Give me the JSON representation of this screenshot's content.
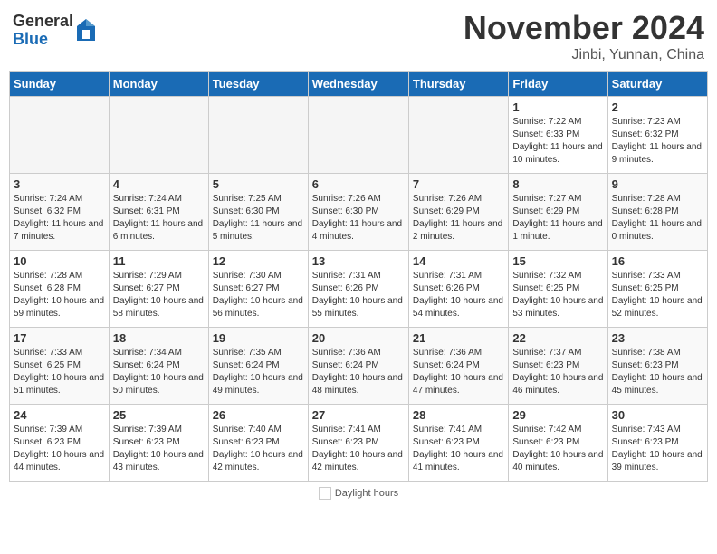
{
  "header": {
    "logo_general": "General",
    "logo_blue": "Blue",
    "title": "November 2024",
    "location": "Jinbi, Yunnan, China"
  },
  "columns": [
    "Sunday",
    "Monday",
    "Tuesday",
    "Wednesday",
    "Thursday",
    "Friday",
    "Saturday"
  ],
  "weeks": [
    [
      {
        "day": "",
        "info": ""
      },
      {
        "day": "",
        "info": ""
      },
      {
        "day": "",
        "info": ""
      },
      {
        "day": "",
        "info": ""
      },
      {
        "day": "",
        "info": ""
      },
      {
        "day": "1",
        "info": "Sunrise: 7:22 AM\nSunset: 6:33 PM\nDaylight: 11 hours and 10 minutes."
      },
      {
        "day": "2",
        "info": "Sunrise: 7:23 AM\nSunset: 6:32 PM\nDaylight: 11 hours and 9 minutes."
      }
    ],
    [
      {
        "day": "3",
        "info": "Sunrise: 7:24 AM\nSunset: 6:32 PM\nDaylight: 11 hours and 7 minutes."
      },
      {
        "day": "4",
        "info": "Sunrise: 7:24 AM\nSunset: 6:31 PM\nDaylight: 11 hours and 6 minutes."
      },
      {
        "day": "5",
        "info": "Sunrise: 7:25 AM\nSunset: 6:30 PM\nDaylight: 11 hours and 5 minutes."
      },
      {
        "day": "6",
        "info": "Sunrise: 7:26 AM\nSunset: 6:30 PM\nDaylight: 11 hours and 4 minutes."
      },
      {
        "day": "7",
        "info": "Sunrise: 7:26 AM\nSunset: 6:29 PM\nDaylight: 11 hours and 2 minutes."
      },
      {
        "day": "8",
        "info": "Sunrise: 7:27 AM\nSunset: 6:29 PM\nDaylight: 11 hours and 1 minute."
      },
      {
        "day": "9",
        "info": "Sunrise: 7:28 AM\nSunset: 6:28 PM\nDaylight: 11 hours and 0 minutes."
      }
    ],
    [
      {
        "day": "10",
        "info": "Sunrise: 7:28 AM\nSunset: 6:28 PM\nDaylight: 10 hours and 59 minutes."
      },
      {
        "day": "11",
        "info": "Sunrise: 7:29 AM\nSunset: 6:27 PM\nDaylight: 10 hours and 58 minutes."
      },
      {
        "day": "12",
        "info": "Sunrise: 7:30 AM\nSunset: 6:27 PM\nDaylight: 10 hours and 56 minutes."
      },
      {
        "day": "13",
        "info": "Sunrise: 7:31 AM\nSunset: 6:26 PM\nDaylight: 10 hours and 55 minutes."
      },
      {
        "day": "14",
        "info": "Sunrise: 7:31 AM\nSunset: 6:26 PM\nDaylight: 10 hours and 54 minutes."
      },
      {
        "day": "15",
        "info": "Sunrise: 7:32 AM\nSunset: 6:25 PM\nDaylight: 10 hours and 53 minutes."
      },
      {
        "day": "16",
        "info": "Sunrise: 7:33 AM\nSunset: 6:25 PM\nDaylight: 10 hours and 52 minutes."
      }
    ],
    [
      {
        "day": "17",
        "info": "Sunrise: 7:33 AM\nSunset: 6:25 PM\nDaylight: 10 hours and 51 minutes."
      },
      {
        "day": "18",
        "info": "Sunrise: 7:34 AM\nSunset: 6:24 PM\nDaylight: 10 hours and 50 minutes."
      },
      {
        "day": "19",
        "info": "Sunrise: 7:35 AM\nSunset: 6:24 PM\nDaylight: 10 hours and 49 minutes."
      },
      {
        "day": "20",
        "info": "Sunrise: 7:36 AM\nSunset: 6:24 PM\nDaylight: 10 hours and 48 minutes."
      },
      {
        "day": "21",
        "info": "Sunrise: 7:36 AM\nSunset: 6:24 PM\nDaylight: 10 hours and 47 minutes."
      },
      {
        "day": "22",
        "info": "Sunrise: 7:37 AM\nSunset: 6:23 PM\nDaylight: 10 hours and 46 minutes."
      },
      {
        "day": "23",
        "info": "Sunrise: 7:38 AM\nSunset: 6:23 PM\nDaylight: 10 hours and 45 minutes."
      }
    ],
    [
      {
        "day": "24",
        "info": "Sunrise: 7:39 AM\nSunset: 6:23 PM\nDaylight: 10 hours and 44 minutes."
      },
      {
        "day": "25",
        "info": "Sunrise: 7:39 AM\nSunset: 6:23 PM\nDaylight: 10 hours and 43 minutes."
      },
      {
        "day": "26",
        "info": "Sunrise: 7:40 AM\nSunset: 6:23 PM\nDaylight: 10 hours and 42 minutes."
      },
      {
        "day": "27",
        "info": "Sunrise: 7:41 AM\nSunset: 6:23 PM\nDaylight: 10 hours and 42 minutes."
      },
      {
        "day": "28",
        "info": "Sunrise: 7:41 AM\nSunset: 6:23 PM\nDaylight: 10 hours and 41 minutes."
      },
      {
        "day": "29",
        "info": "Sunrise: 7:42 AM\nSunset: 6:23 PM\nDaylight: 10 hours and 40 minutes."
      },
      {
        "day": "30",
        "info": "Sunrise: 7:43 AM\nSunset: 6:23 PM\nDaylight: 10 hours and 39 minutes."
      }
    ]
  ],
  "footer": {
    "daylight_label": "Daylight hours"
  }
}
